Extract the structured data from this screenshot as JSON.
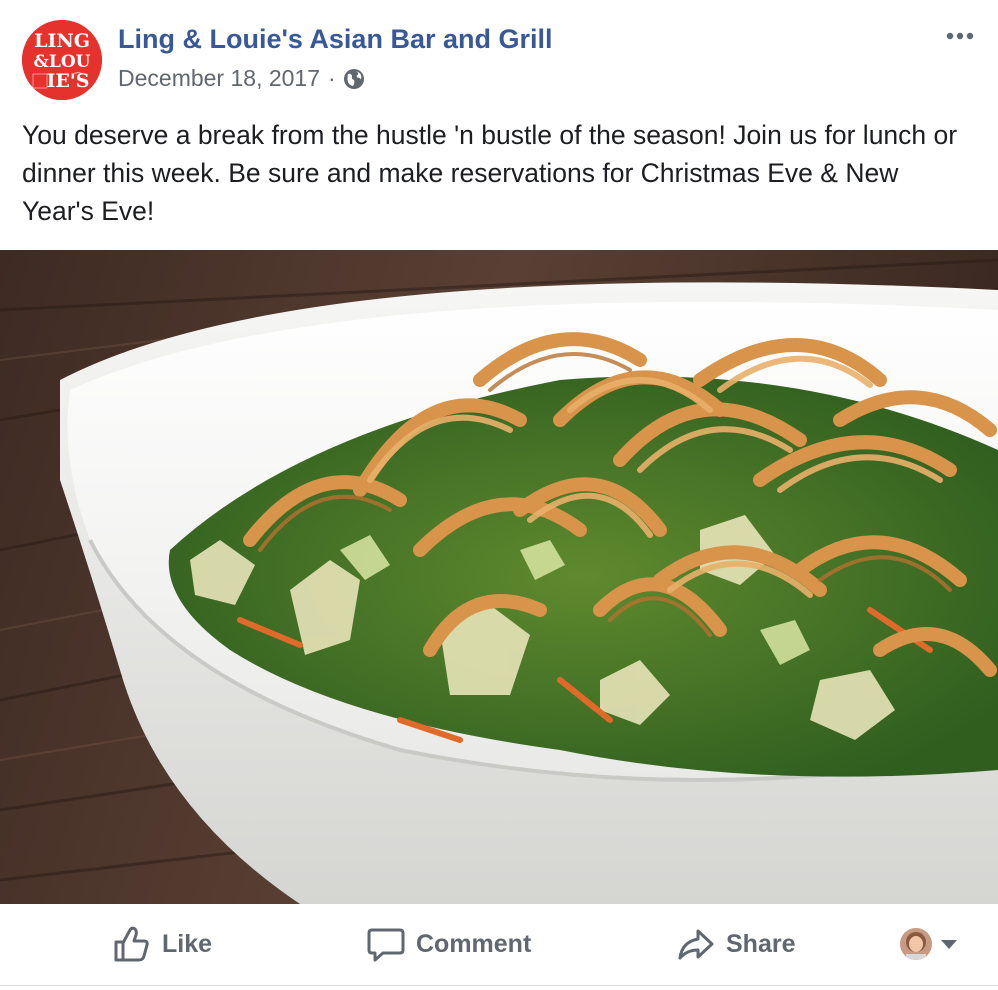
{
  "post": {
    "page_name": "Ling & Louie's Asian Bar and Grill",
    "date": "December 18, 2017",
    "separator": "·",
    "privacy_icon": "globe-icon",
    "more_icon": "more-horizontal-icon",
    "text": "You deserve a break from the hustle 'n bustle of the season! Join us for lunch or dinner this week. Be sure and make reservations for Christmas Eve & New Year's Eve!",
    "avatar_logo": {
      "line1": "LING",
      "line2": "&LOU",
      "line3": "IE'S",
      "brand_color": "#e5322d"
    },
    "photo_subject": "salad-bowl-image"
  },
  "actions": {
    "like_label": "Like",
    "comment_label": "Comment",
    "share_label": "Share",
    "like_icon": "thumbs-up-icon",
    "comment_icon": "speech-bubble-icon",
    "share_icon": "share-arrow-icon",
    "viewer_icon": "viewer-avatar",
    "dropdown_icon": "caret-down-icon"
  },
  "colors": {
    "link": "#385898",
    "secondary_text": "#616770",
    "body_text": "#1c1e21",
    "action_text": "#606770"
  }
}
